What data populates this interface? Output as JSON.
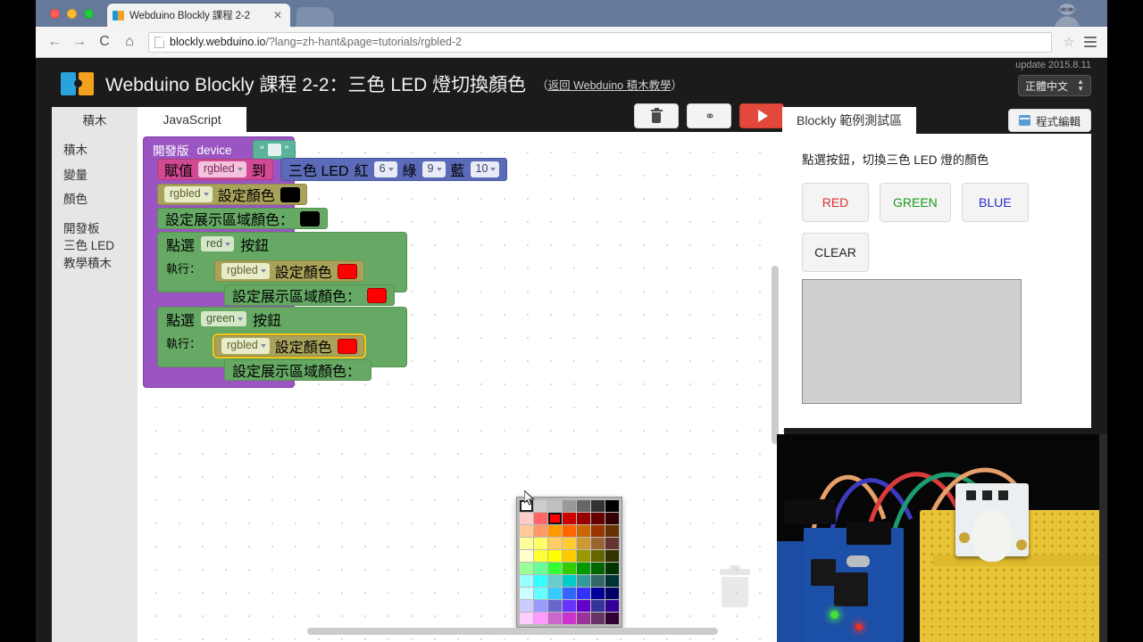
{
  "browser": {
    "tab_title": "Webduino Blockly 課程 2-2",
    "tab_close_glyph": "✕",
    "url_host": "blockly.webduino.io",
    "url_path": "/?lang=zh-hant&page=tutorials/rgbled-2",
    "nav": {
      "back": "←",
      "forward": "→",
      "reload": "C",
      "home": "⌂"
    },
    "star_glyph": "☆"
  },
  "header": {
    "update_stamp": "update 2015.8.11",
    "title": "Webduino Blockly 課程 2-2：三色 LED 燈切換顏色",
    "back_link_open": "（",
    "back_link_text": "返回 Webduino 積木教學",
    "back_link_close": "）",
    "language": "正體中文",
    "language_arrows": "⬍"
  },
  "editor": {
    "tabs": [
      {
        "label": "積木",
        "active": false
      },
      {
        "label": "JavaScript",
        "active": true
      }
    ],
    "toolbar": [
      {
        "name": "delete-button",
        "label": ""
      },
      {
        "name": "link-button",
        "label": "∞"
      },
      {
        "name": "run-button",
        "label": ""
      }
    ],
    "flyout_items": [
      "積木",
      "變量",
      "顏色",
      "開發板",
      "三色 LED",
      "教學積木"
    ]
  },
  "blocks": {
    "device_label": "開發版",
    "device_name": "device",
    "quote_open": "“",
    "quote_close": "”",
    "assign_label": "賦值",
    "assign_var": "rgbled",
    "assign_to": "到",
    "rgbled_title": "三色 LED",
    "pin_red_label": "紅",
    "pin_red_value": "6",
    "pin_green_label": "綠",
    "pin_green_value": "9",
    "pin_blue_label": "藍",
    "pin_blue_value": "10",
    "set_color_var": "rgbled",
    "set_color_label": "設定顏色",
    "set_area_label": "設定展示區域顏色：",
    "on_click_prefix": "點選",
    "on_click_suffix": "按鈕",
    "exec_label": "執行：",
    "event_red": "red",
    "event_green": "green",
    "color_black": "#000000",
    "color_red": "#ff0000"
  },
  "color_picker": {
    "selected": "#ffffff",
    "swatches": [
      "#ffffff",
      "#cccccc",
      "#c0c0c0",
      "#999999",
      "#666666",
      "#333333",
      "#000000",
      "#ffcccc",
      "#ff6666",
      "#ff0000",
      "#cc0000",
      "#990000",
      "#660000",
      "#330000",
      "#ffcc99",
      "#ff9966",
      "#ff9900",
      "#ff6600",
      "#cc6600",
      "#993300",
      "#663300",
      "#ffff99",
      "#ffff66",
      "#ffcc66",
      "#ffcc33",
      "#cc9933",
      "#996633",
      "#663333",
      "#ffffcc",
      "#ffff33",
      "#ffff00",
      "#ffcc00",
      "#999900",
      "#666600",
      "#333300",
      "#99ff99",
      "#66ff99",
      "#33ff33",
      "#33cc00",
      "#009900",
      "#006600",
      "#003300",
      "#99ffff",
      "#33ffff",
      "#66cccc",
      "#00cccc",
      "#339999",
      "#336666",
      "#003333",
      "#ccffff",
      "#66ffff",
      "#33ccff",
      "#3366ff",
      "#3333ff",
      "#000099",
      "#000066",
      "#ccccff",
      "#9999ff",
      "#6666cc",
      "#6633ff",
      "#6600cc",
      "#333399",
      "#330099",
      "#ffccff",
      "#ff99ff",
      "#cc66cc",
      "#cc33cc",
      "#993399",
      "#663366",
      "#330033"
    ]
  },
  "demo": {
    "tab_label": "Blockly 範例測試區",
    "code_edit_button": "程式編輯",
    "caption": "點選按鈕，切換三色 LED 燈的顏色",
    "buttons": [
      {
        "label": "RED",
        "color": "#e03030"
      },
      {
        "label": "GREEN",
        "color": "#1a9b1a"
      },
      {
        "label": "BLUE",
        "color": "#2a2ad0"
      },
      {
        "label": "CLEAR",
        "color": "#222222"
      }
    ]
  }
}
